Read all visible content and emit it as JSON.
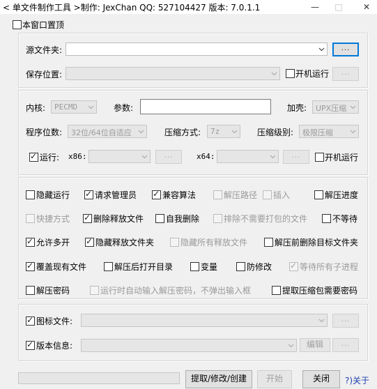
{
  "title": {
    "text": "< 单文件制作工具 >制作: JexChan  QQ: 527104427  版本: 7.0.1.1",
    "minimize": "—",
    "maximize": "□",
    "close": "✕"
  },
  "topmost": {
    "label": "本窗口置顶",
    "checked": false
  },
  "source": {
    "folder_label": "源文件夹:",
    "folder_value": "",
    "browse_label": "...",
    "save_label": "保存位置:",
    "save_value": "",
    "save_browse_label": "...",
    "autorun_label": "开机运行",
    "autorun_checked": false
  },
  "kernel": {
    "kernel_label": "内核:",
    "kernel_value": "PECMD",
    "param_label": "参数:",
    "param_value": "",
    "shell_label": "加壳:",
    "shell_value": "UPX压缩",
    "bits_label": "程序位数:",
    "bits_value": "32位/64位自适应",
    "compress_method_label": "压缩方式:",
    "compress_method_value": "7z",
    "compress_level_label": "压缩级别:",
    "compress_level_value": "极限压缩",
    "run_label": "运行:",
    "run_checked": true,
    "x86_label": "x86:",
    "x86_value": "",
    "x86_browse": "...",
    "x64_label": "x64:",
    "x64_value": "",
    "x64_browse": "...",
    "autorun2_label": "开机运行",
    "autorun2_checked": false
  },
  "options": [
    {
      "label": "隐藏运行",
      "checked": false,
      "disabled": false
    },
    {
      "label": "请求管理员",
      "checked": true,
      "disabled": false
    },
    {
      "label": "兼容算法",
      "checked": true,
      "disabled": false
    },
    {
      "label": "解压路径",
      "checked": false,
      "disabled": true
    },
    {
      "label": "插入",
      "checked": false,
      "disabled": true
    },
    {
      "label": "解压进度",
      "checked": false,
      "disabled": false
    },
    {
      "label": "快捷方式",
      "checked": false,
      "disabled": true
    },
    {
      "label": "删除释放文件",
      "checked": true,
      "disabled": false
    },
    {
      "label": "自我删除",
      "checked": false,
      "disabled": false
    },
    {
      "label": "排除不需要打包的文件",
      "checked": false,
      "disabled": true
    },
    {
      "label": "不等待",
      "checked": false,
      "disabled": false
    },
    {
      "label": "允许多开",
      "checked": true,
      "disabled": false
    },
    {
      "label": "隐藏释放文件夹",
      "checked": true,
      "disabled": false
    },
    {
      "label": "隐藏所有释放文件",
      "checked": false,
      "disabled": true
    },
    {
      "label": "解压前删除目标文件夹",
      "checked": false,
      "disabled": false
    },
    {
      "label": "覆盖现有文件",
      "checked": true,
      "disabled": false
    },
    {
      "label": "解压后打开目录",
      "checked": false,
      "disabled": false
    },
    {
      "label": "变量",
      "checked": false,
      "disabled": false
    },
    {
      "label": "防修改",
      "checked": false,
      "disabled": false
    },
    {
      "label": "等待所有子进程",
      "checked": true,
      "disabled": true
    },
    {
      "label": "解压密码",
      "checked": false,
      "disabled": false
    },
    {
      "label": "运行时自动输入解压密码，不弹出输入框",
      "checked": false,
      "disabled": true
    },
    {
      "label": "提取压缩包需要密码",
      "checked": false,
      "disabled": false
    }
  ],
  "resources": {
    "icon_label": "图标文件:",
    "icon_checked": true,
    "icon_value": "",
    "icon_browse": "...",
    "version_label": "版本信息:",
    "version_checked": true,
    "version_value": "",
    "edit_label": "编辑",
    "version_browse": "..."
  },
  "bottom": {
    "status": "",
    "extract_label": "提取/修改/创建",
    "start_label": "开始",
    "close_label": "关闭",
    "about_label": "?)关于"
  }
}
